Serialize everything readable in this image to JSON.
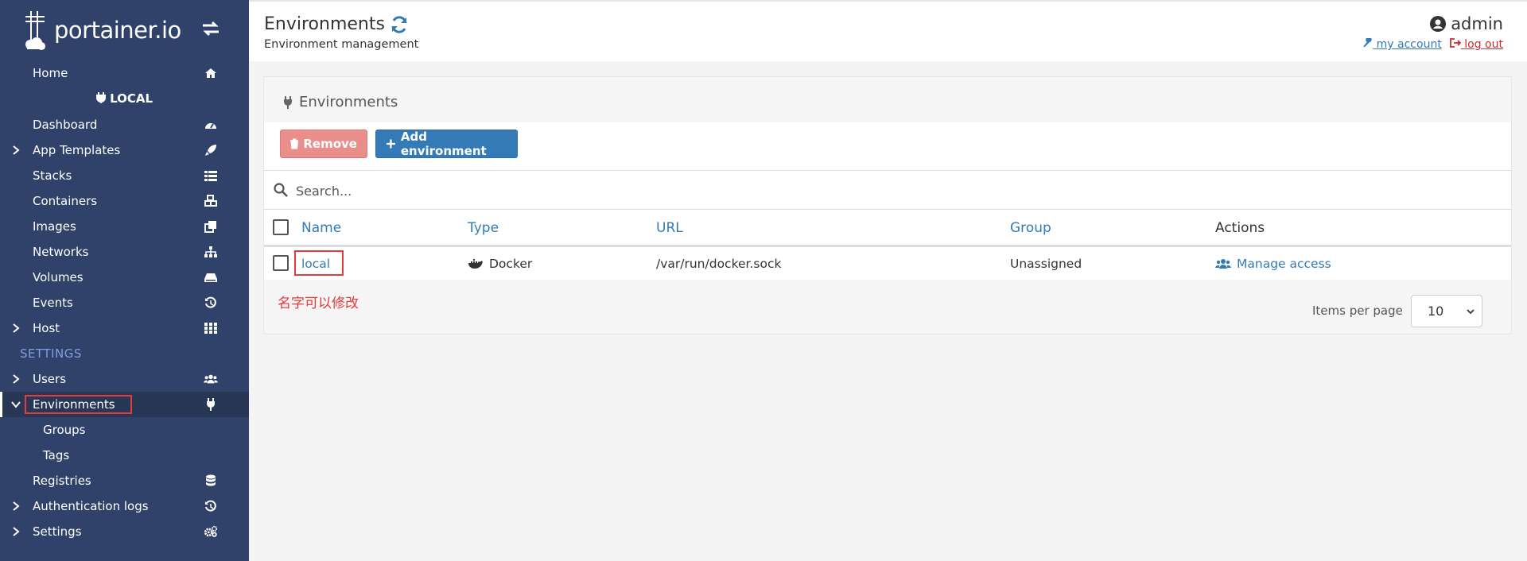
{
  "brand": {
    "name": "portainer.io"
  },
  "sidebar": {
    "home": "Home",
    "endpoint_label": "LOCAL",
    "items": [
      {
        "label": "Dashboard",
        "icon": "dashboard-icon"
      },
      {
        "label": "App Templates",
        "icon": "rocket-icon"
      },
      {
        "label": "Stacks",
        "icon": "list-icon"
      },
      {
        "label": "Containers",
        "icon": "cubes-icon"
      },
      {
        "label": "Images",
        "icon": "clone-icon"
      },
      {
        "label": "Networks",
        "icon": "sitemap-icon"
      },
      {
        "label": "Volumes",
        "icon": "hdd-icon"
      },
      {
        "label": "Events",
        "icon": "history-icon"
      },
      {
        "label": "Host",
        "icon": "grid-icon"
      }
    ],
    "settings_section": "SETTINGS",
    "settings_items": [
      {
        "label": "Users",
        "icon": "users-icon"
      },
      {
        "label": "Environments",
        "icon": "plug-icon"
      },
      {
        "label": "Groups"
      },
      {
        "label": "Tags"
      },
      {
        "label": "Registries",
        "icon": "database-icon"
      },
      {
        "label": "Authentication logs",
        "icon": "history-icon"
      },
      {
        "label": "Settings",
        "icon": "cogs-icon"
      }
    ]
  },
  "header": {
    "title": "Environments",
    "subtitle": "Environment management",
    "user": "admin",
    "my_account": "my account",
    "log_out": "log out"
  },
  "panel": {
    "title": "Environments",
    "remove_label": "Remove",
    "add_label": "Add environment",
    "search_placeholder": "Search...",
    "columns": [
      "Name",
      "Type",
      "URL",
      "Group",
      "Actions"
    ],
    "rows": [
      {
        "name": "local",
        "type": "Docker",
        "url": "/var/run/docker.sock",
        "group": "Unassigned",
        "action": "Manage access"
      }
    ],
    "annotation": "名字可以修改",
    "items_per_page_label": "Items per page",
    "items_per_page_value": "10"
  },
  "colors": {
    "sidebar_bg": "#30426a",
    "primary": "#337ab7",
    "danger": "#e98e8a",
    "highlight": "#e23c3c"
  }
}
